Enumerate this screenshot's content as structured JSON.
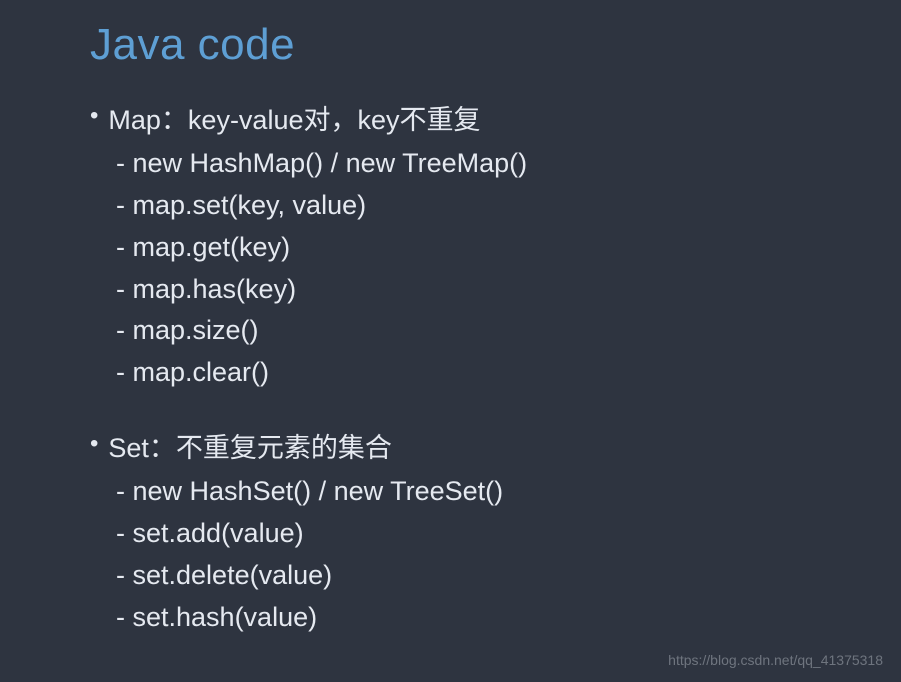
{
  "title": "Java code",
  "sections": [
    {
      "header": "Map：key-value对，key不重复",
      "items": [
        "new HashMap() / new TreeMap()",
        "map.set(key, value)",
        "map.get(key)",
        "map.has(key)",
        "map.size()",
        "map.clear()"
      ]
    },
    {
      "header": "Set：不重复元素的集合",
      "items": [
        "new HashSet() / new TreeSet()",
        "set.add(value)",
        "set.delete(value)",
        "set.hash(value)"
      ]
    }
  ],
  "watermark": "https://blog.csdn.net/qq_41375318"
}
